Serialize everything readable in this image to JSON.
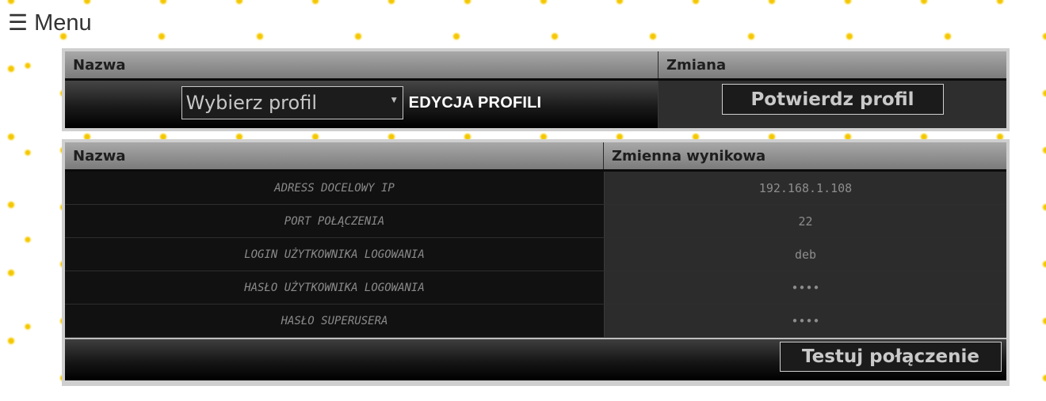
{
  "menu": {
    "icon": "hamburger-icon",
    "label": "Menu"
  },
  "profile_panel": {
    "headers": {
      "name": "Nazwa",
      "change": "Zmiana"
    },
    "profile_select": {
      "selected": "Wybierz profil"
    },
    "edit_profiles_label": "EDYCJA PROFILI",
    "confirm_button": "Potwierdz profil"
  },
  "variables_panel": {
    "headers": {
      "name": "Nazwa",
      "value": "Zmienna wynikowa"
    },
    "rows": [
      {
        "name": "ADRESS DOCELOWY IP",
        "value": "192.168.1.108"
      },
      {
        "name": "PORT POŁĄCZENIA",
        "value": "22"
      },
      {
        "name": "LOGIN UŻYTKOWNIKA LOGOWANIA",
        "value": "deb"
      },
      {
        "name": "HASŁO UŻYTKOWNIKA LOGOWANIA",
        "value": "••••"
      },
      {
        "name": "HASŁO SUPERUSERA",
        "value": "••••"
      }
    ],
    "test_button": "Testuj połączenie"
  },
  "colors": {
    "background_dots": "#f6cd10",
    "header_gradient_top": "#a8a8a8",
    "header_gradient_bottom": "#7b7b7b",
    "panel_border": "#cfcfcf"
  }
}
